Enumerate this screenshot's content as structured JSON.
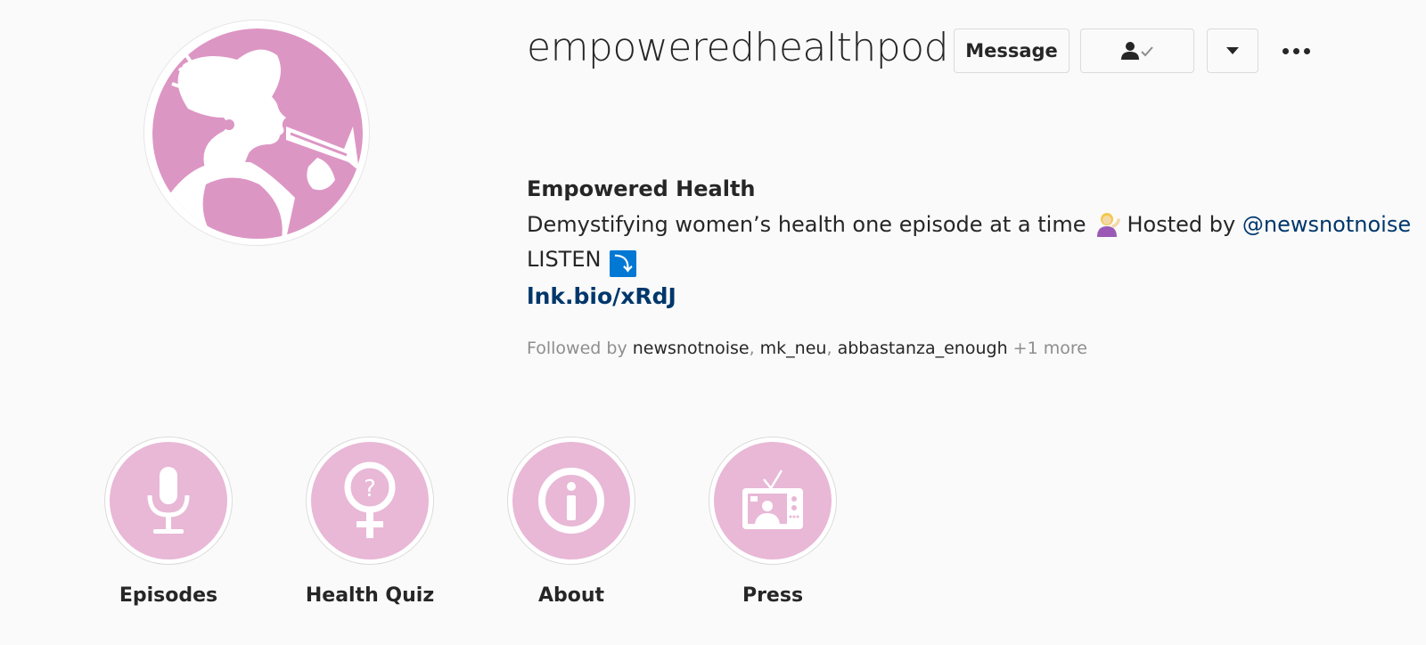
{
  "profile": {
    "username": "empoweredhealthpod",
    "full_name": "Empowered Health",
    "bio_text": "Demystifying women’s health one episode at a time",
    "bio_hosted_by": "Hosted by",
    "bio_mention": "@newsnotnoise",
    "listen_text": "LISTEN",
    "listen_emoji": "⤵",
    "link": "lnk.bio/xRdJ",
    "avatar_icon": "woman-megaphone-icon"
  },
  "actions": {
    "message_label": "Message",
    "following_icon": "person-check-icon",
    "dropdown_icon": "caret-down-icon",
    "more_icon": "more-options-icon"
  },
  "followed_by": {
    "prefix": "Followed by",
    "users": [
      "newsnotnoise",
      "mk_neu",
      "abbastanza_enough"
    ],
    "suffix": "+1 more"
  },
  "highlights": [
    {
      "label": "Episodes",
      "icon": "microphone-icon"
    },
    {
      "label": "Health Quiz",
      "icon": "venus-question-icon"
    },
    {
      "label": "About",
      "icon": "info-icon"
    },
    {
      "label": "Press",
      "icon": "tv-icon"
    }
  ],
  "colors": {
    "brand_pink": "#dc96c4",
    "highlight_pink": "#e8b8d6",
    "link_blue": "#00376b",
    "text": "#262626",
    "muted": "#8e8e8e"
  }
}
